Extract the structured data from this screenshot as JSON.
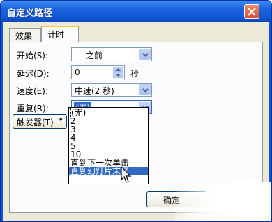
{
  "window": {
    "title": "自定义路径"
  },
  "tabs": [
    {
      "label": "效果",
      "active": false
    },
    {
      "label": "计时",
      "active": true
    }
  ],
  "fields": {
    "start": {
      "label": "开始(S):",
      "value": "之前",
      "icon": "chevron-down-icon"
    },
    "delay": {
      "label": "延迟(D):",
      "value": "0",
      "unit": "秒",
      "icon": "spinner-icon"
    },
    "speed": {
      "label": "速度(E):",
      "value": "中速(2 秒)",
      "icon": "chevron-down-icon"
    },
    "repeat": {
      "label": "重复(R):",
      "value": "(无)",
      "icon": "chevron-down-icon"
    }
  },
  "trigger_button": {
    "label": "触发器(T)",
    "icon": "chevron-double-down-icon"
  },
  "repeat_options": [
    {
      "label": "(无)",
      "selected": false
    },
    {
      "label": "2",
      "selected": false
    },
    {
      "label": "3",
      "selected": false
    },
    {
      "label": "4",
      "selected": false
    },
    {
      "label": "5",
      "selected": false
    },
    {
      "label": "10",
      "selected": false
    },
    {
      "label": "直到下一次单击",
      "selected": false
    },
    {
      "label": "直到幻灯片末尾",
      "selected": true
    }
  ],
  "buttons": {
    "ok_label": "确定"
  },
  "colors": {
    "titlebar": "#0a56d8",
    "selection": "#316ac5",
    "tab_accent": "#ffc83c"
  }
}
